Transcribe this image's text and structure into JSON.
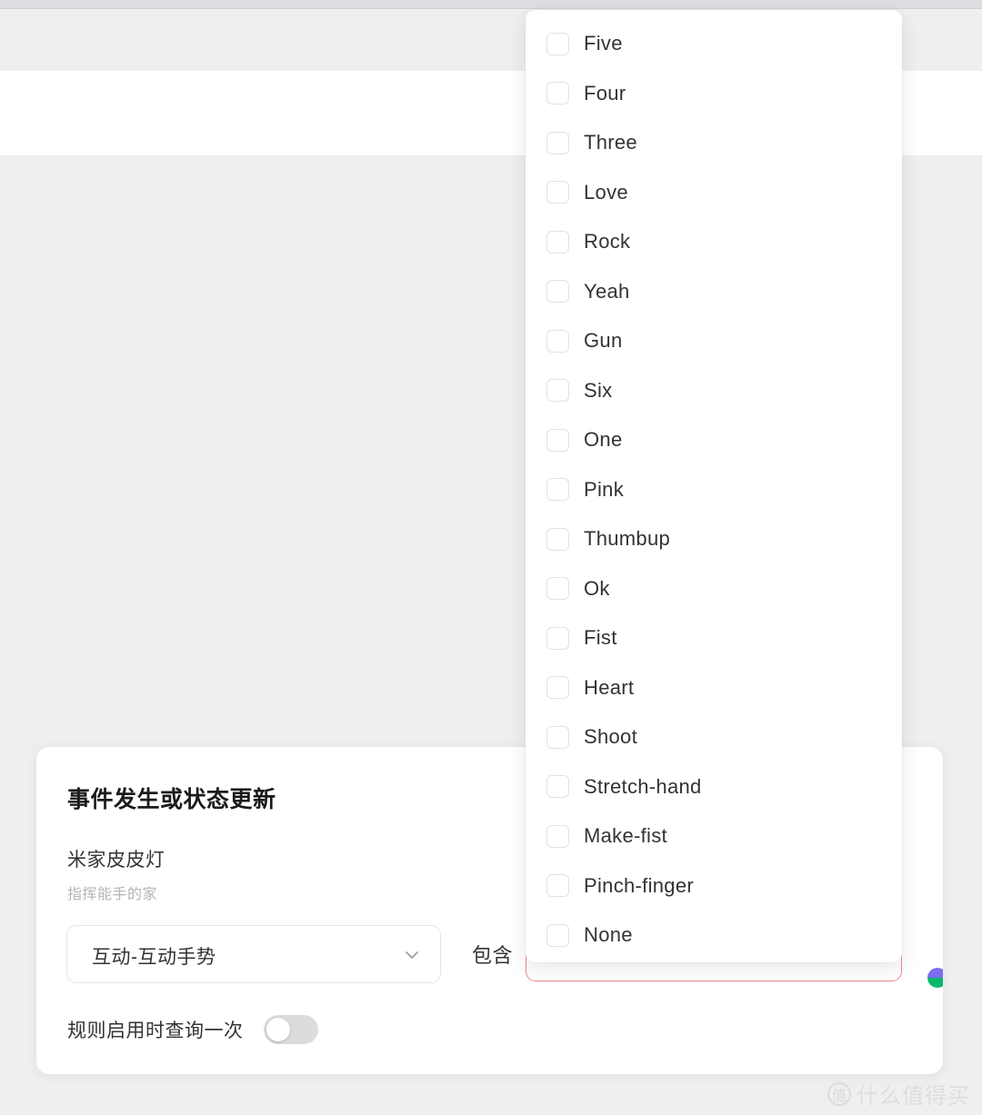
{
  "window": {
    "chrome_strip_color": "#dcdee2",
    "toolbar_band_color": "#efefef",
    "content_band_color": "#ffffff",
    "page_background_color": "#efefef"
  },
  "card": {
    "title": "事件发生或状态更新",
    "device_name": "米家皮皮灯",
    "device_room": "指挥能手的家",
    "property_select": {
      "value": "互动-互动手势",
      "chevron_icon": "chevron-down-icon"
    },
    "operator_label": "包含",
    "value_field": {
      "value": "",
      "border_color": "#f08a8a"
    },
    "status_dot": {
      "top_color": "#7c6df0",
      "bottom_color": "#0ab96a"
    },
    "query_once": {
      "label": "规则启用时查询一次",
      "enabled": false
    }
  },
  "dropdown": {
    "multi_select": true,
    "items": [
      {
        "label": "Five",
        "checked": false
      },
      {
        "label": "Four",
        "checked": false
      },
      {
        "label": "Three",
        "checked": false
      },
      {
        "label": "Love",
        "checked": false
      },
      {
        "label": "Rock",
        "checked": false
      },
      {
        "label": "Yeah",
        "checked": false
      },
      {
        "label": "Gun",
        "checked": false
      },
      {
        "label": "Six",
        "checked": false
      },
      {
        "label": "One",
        "checked": false
      },
      {
        "label": "Pink",
        "checked": false
      },
      {
        "label": "Thumbup",
        "checked": false
      },
      {
        "label": "Ok",
        "checked": false
      },
      {
        "label": "Fist",
        "checked": false
      },
      {
        "label": "Heart",
        "checked": false
      },
      {
        "label": "Shoot",
        "checked": false
      },
      {
        "label": "Stretch-hand",
        "checked": false
      },
      {
        "label": "Make-fist",
        "checked": false
      },
      {
        "label": "Pinch-finger",
        "checked": false
      },
      {
        "label": "None",
        "checked": false
      }
    ]
  },
  "watermark": {
    "badge": "值",
    "text": "什么值得买"
  }
}
